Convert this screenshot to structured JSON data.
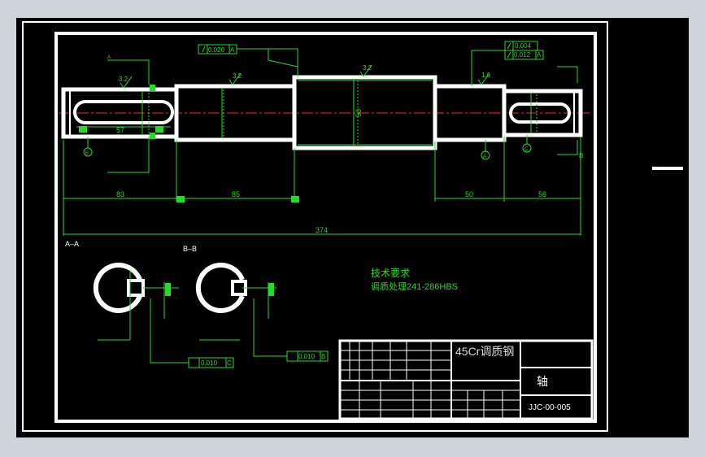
{
  "drawing": {
    "colors": {
      "outline": "#ffffff",
      "dimension": "#22dd22",
      "centerline": "#ff2222",
      "background": "#000000",
      "surround": "#cdd4db"
    },
    "section_labels": {
      "aa": "A–A",
      "bb": "B–B"
    },
    "tolerance_frames": {
      "top_runout": {
        "value": "0.020",
        "datum": "A"
      },
      "top_right_1": {
        "value": "0.004"
      },
      "top_right_2": {
        "value": "0.012",
        "datum": "A"
      },
      "aa_bottom": {
        "value": "0.010",
        "datum": "C"
      },
      "bb_bottom": {
        "value": "0.010",
        "datum": "B"
      }
    },
    "roughness": {
      "r1": "3.2",
      "r2": "3.2",
      "r3": "3.2",
      "r4": "1.6"
    },
    "dimensions": {
      "d83": "83",
      "d85": "85",
      "d50h": "50",
      "d56": "56",
      "d374": "374",
      "d50v": "50",
      "d57": "57"
    },
    "section_markers": {
      "a": "A",
      "b": "B"
    },
    "datum_markers": {
      "b": "B",
      "a": "A",
      "c": "C"
    },
    "tech_req": {
      "title": "技术要求",
      "line1": "调质处理241-286HBS"
    },
    "title_block": {
      "material": "45Cr调质钢",
      "part_name": "轴",
      "drawing_number": "JJC-00-005"
    }
  }
}
